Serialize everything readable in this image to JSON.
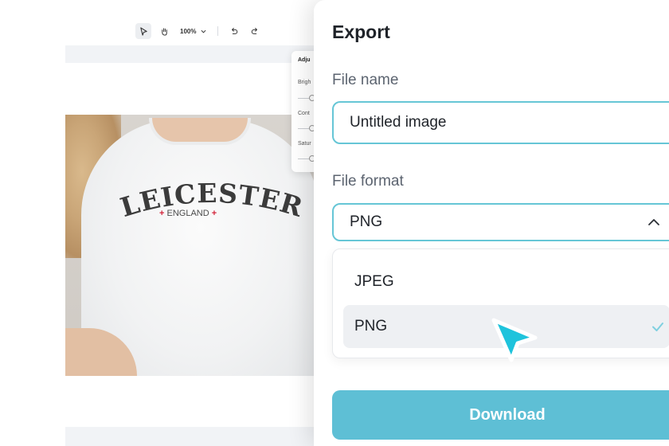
{
  "toolbar": {
    "zoom": "100%"
  },
  "photo": {
    "print_main": "LEICESTER",
    "print_sub": "ENGLAND",
    "cross": "+"
  },
  "adjust_panel": {
    "title": "Adju",
    "labels": [
      "Brigh",
      "Cont",
      "Satur"
    ]
  },
  "export": {
    "title": "Export",
    "file_name_label": "File name",
    "file_name_value": "Untitled image",
    "file_format_label": "File format",
    "selected_format": "PNG",
    "options": [
      "JPEG",
      "PNG"
    ],
    "download_label": "Download"
  },
  "colors": {
    "accent": "#5ebfd5",
    "focus_border": "#66c6d6",
    "cursor": "#1ec3dc",
    "check": "#7fd0e0"
  },
  "icons": [
    "select-pointer-icon",
    "hand-icon",
    "chevron-down-icon",
    "undo-icon",
    "redo-icon",
    "chevron-up-icon",
    "checkmark-icon",
    "cursor-arrow-icon"
  ]
}
